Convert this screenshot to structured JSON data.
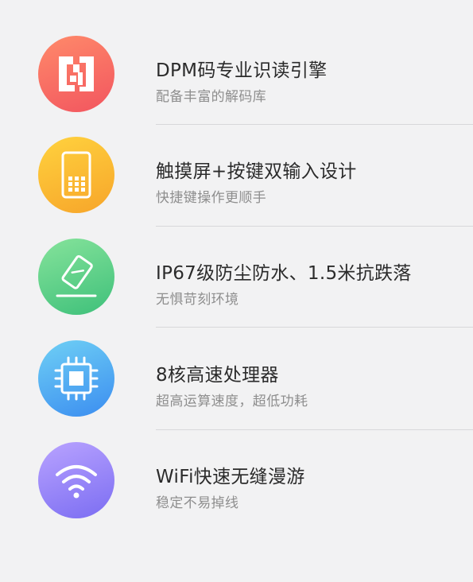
{
  "features": [
    {
      "title": "DPM码专业识读引擎",
      "subtitle": "配备丰富的解码库",
      "icon": "dpm-code-icon",
      "gradient": [
        "#ff8a6a",
        "#f2555f"
      ]
    },
    {
      "title": "触摸屏+按键双输入设计",
      "subtitle": "快捷键操作更顺手",
      "icon": "keypad-phone-icon",
      "gradient": [
        "#ffd23e",
        "#f7a52a"
      ]
    },
    {
      "title": "IP67级防尘防水、1.5米抗跌落",
      "subtitle": "无惧苛刻环境",
      "icon": "drop-device-icon",
      "gradient": [
        "#86e39b",
        "#3ec07a"
      ]
    },
    {
      "title": "8核高速处理器",
      "subtitle": "超高运算速度，超低功耗",
      "icon": "processor-chip-icon",
      "gradient": [
        "#6fd0f5",
        "#3b8df0"
      ]
    },
    {
      "title": "WiFi快速无缝漫游",
      "subtitle": "稳定不易掉线",
      "icon": "wifi-icon",
      "gradient": [
        "#b9a3ff",
        "#7b6df2"
      ]
    }
  ]
}
